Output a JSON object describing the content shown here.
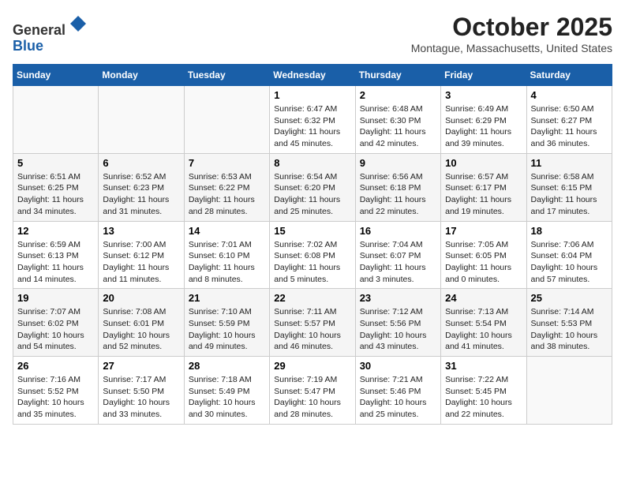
{
  "header": {
    "logo_line1": "General",
    "logo_line2": "Blue",
    "month": "October 2025",
    "location": "Montague, Massachusetts, United States"
  },
  "days_of_week": [
    "Sunday",
    "Monday",
    "Tuesday",
    "Wednesday",
    "Thursday",
    "Friday",
    "Saturday"
  ],
  "weeks": [
    [
      {
        "day": "",
        "info": ""
      },
      {
        "day": "",
        "info": ""
      },
      {
        "day": "",
        "info": ""
      },
      {
        "day": "1",
        "info": "Sunrise: 6:47 AM\nSunset: 6:32 PM\nDaylight: 11 hours\nand 45 minutes."
      },
      {
        "day": "2",
        "info": "Sunrise: 6:48 AM\nSunset: 6:30 PM\nDaylight: 11 hours\nand 42 minutes."
      },
      {
        "day": "3",
        "info": "Sunrise: 6:49 AM\nSunset: 6:29 PM\nDaylight: 11 hours\nand 39 minutes."
      },
      {
        "day": "4",
        "info": "Sunrise: 6:50 AM\nSunset: 6:27 PM\nDaylight: 11 hours\nand 36 minutes."
      }
    ],
    [
      {
        "day": "5",
        "info": "Sunrise: 6:51 AM\nSunset: 6:25 PM\nDaylight: 11 hours\nand 34 minutes."
      },
      {
        "day": "6",
        "info": "Sunrise: 6:52 AM\nSunset: 6:23 PM\nDaylight: 11 hours\nand 31 minutes."
      },
      {
        "day": "7",
        "info": "Sunrise: 6:53 AM\nSunset: 6:22 PM\nDaylight: 11 hours\nand 28 minutes."
      },
      {
        "day": "8",
        "info": "Sunrise: 6:54 AM\nSunset: 6:20 PM\nDaylight: 11 hours\nand 25 minutes."
      },
      {
        "day": "9",
        "info": "Sunrise: 6:56 AM\nSunset: 6:18 PM\nDaylight: 11 hours\nand 22 minutes."
      },
      {
        "day": "10",
        "info": "Sunrise: 6:57 AM\nSunset: 6:17 PM\nDaylight: 11 hours\nand 19 minutes."
      },
      {
        "day": "11",
        "info": "Sunrise: 6:58 AM\nSunset: 6:15 PM\nDaylight: 11 hours\nand 17 minutes."
      }
    ],
    [
      {
        "day": "12",
        "info": "Sunrise: 6:59 AM\nSunset: 6:13 PM\nDaylight: 11 hours\nand 14 minutes."
      },
      {
        "day": "13",
        "info": "Sunrise: 7:00 AM\nSunset: 6:12 PM\nDaylight: 11 hours\nand 11 minutes."
      },
      {
        "day": "14",
        "info": "Sunrise: 7:01 AM\nSunset: 6:10 PM\nDaylight: 11 hours\nand 8 minutes."
      },
      {
        "day": "15",
        "info": "Sunrise: 7:02 AM\nSunset: 6:08 PM\nDaylight: 11 hours\nand 5 minutes."
      },
      {
        "day": "16",
        "info": "Sunrise: 7:04 AM\nSunset: 6:07 PM\nDaylight: 11 hours\nand 3 minutes."
      },
      {
        "day": "17",
        "info": "Sunrise: 7:05 AM\nSunset: 6:05 PM\nDaylight: 11 hours\nand 0 minutes."
      },
      {
        "day": "18",
        "info": "Sunrise: 7:06 AM\nSunset: 6:04 PM\nDaylight: 10 hours\nand 57 minutes."
      }
    ],
    [
      {
        "day": "19",
        "info": "Sunrise: 7:07 AM\nSunset: 6:02 PM\nDaylight: 10 hours\nand 54 minutes."
      },
      {
        "day": "20",
        "info": "Sunrise: 7:08 AM\nSunset: 6:01 PM\nDaylight: 10 hours\nand 52 minutes."
      },
      {
        "day": "21",
        "info": "Sunrise: 7:10 AM\nSunset: 5:59 PM\nDaylight: 10 hours\nand 49 minutes."
      },
      {
        "day": "22",
        "info": "Sunrise: 7:11 AM\nSunset: 5:57 PM\nDaylight: 10 hours\nand 46 minutes."
      },
      {
        "day": "23",
        "info": "Sunrise: 7:12 AM\nSunset: 5:56 PM\nDaylight: 10 hours\nand 43 minutes."
      },
      {
        "day": "24",
        "info": "Sunrise: 7:13 AM\nSunset: 5:54 PM\nDaylight: 10 hours\nand 41 minutes."
      },
      {
        "day": "25",
        "info": "Sunrise: 7:14 AM\nSunset: 5:53 PM\nDaylight: 10 hours\nand 38 minutes."
      }
    ],
    [
      {
        "day": "26",
        "info": "Sunrise: 7:16 AM\nSunset: 5:52 PM\nDaylight: 10 hours\nand 35 minutes."
      },
      {
        "day": "27",
        "info": "Sunrise: 7:17 AM\nSunset: 5:50 PM\nDaylight: 10 hours\nand 33 minutes."
      },
      {
        "day": "28",
        "info": "Sunrise: 7:18 AM\nSunset: 5:49 PM\nDaylight: 10 hours\nand 30 minutes."
      },
      {
        "day": "29",
        "info": "Sunrise: 7:19 AM\nSunset: 5:47 PM\nDaylight: 10 hours\nand 28 minutes."
      },
      {
        "day": "30",
        "info": "Sunrise: 7:21 AM\nSunset: 5:46 PM\nDaylight: 10 hours\nand 25 minutes."
      },
      {
        "day": "31",
        "info": "Sunrise: 7:22 AM\nSunset: 5:45 PM\nDaylight: 10 hours\nand 22 minutes."
      },
      {
        "day": "",
        "info": ""
      }
    ]
  ]
}
